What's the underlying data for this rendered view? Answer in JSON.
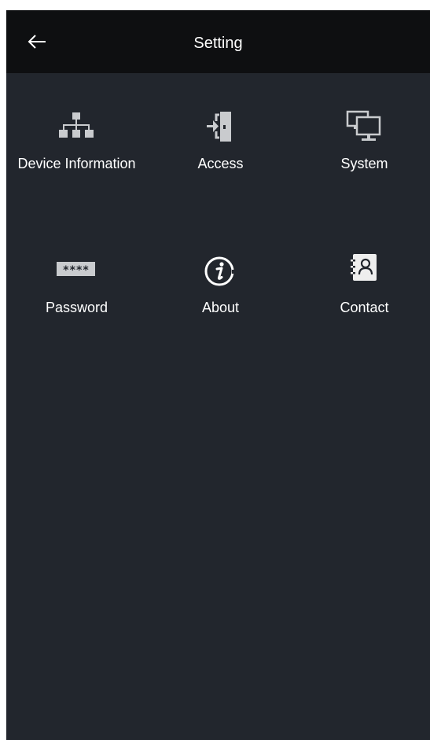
{
  "header": {
    "title": "Setting",
    "back_icon": "back-arrow-icon"
  },
  "menu": {
    "items": [
      {
        "label": "Device Information",
        "icon": "network-tree-icon"
      },
      {
        "label": "Access",
        "icon": "door-entry-icon"
      },
      {
        "label": "System",
        "icon": "monitors-icon"
      },
      {
        "label": "Password",
        "icon": "password-mask-icon",
        "icon_text": "****"
      },
      {
        "label": "About",
        "icon": "info-circle-icon"
      },
      {
        "label": "Contact",
        "icon": "contact-book-icon"
      }
    ]
  },
  "colors": {
    "topbar": "#0e0f11",
    "background": "#22262d",
    "icon": "#c9cbce",
    "text": "#ffffff"
  }
}
